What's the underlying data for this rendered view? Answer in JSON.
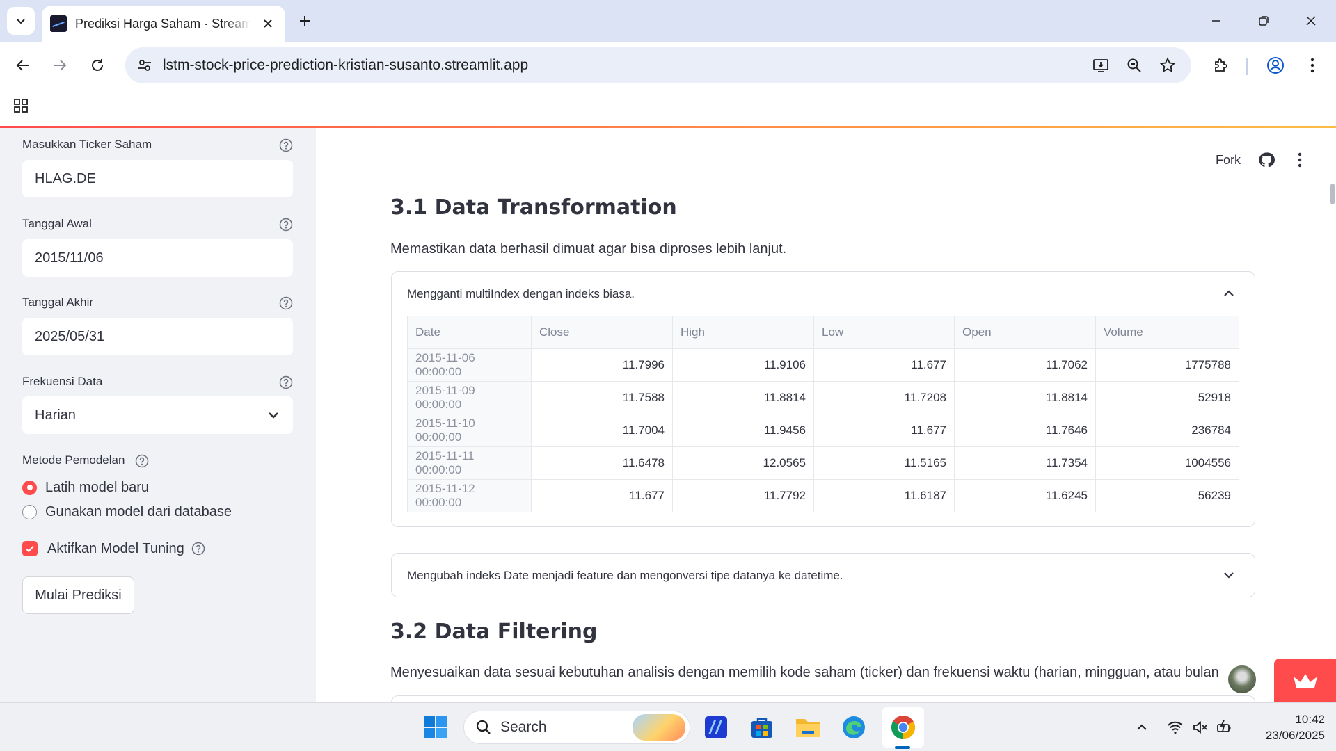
{
  "browser": {
    "tab_title": "Prediksi Harga Saham · Streamlit",
    "url": "lstm-stock-price-prediction-kristian-susanto.streamlit.app"
  },
  "sidebar": {
    "ticker_label": "Masukkan Ticker Saham",
    "ticker_value": "HLAG.DE",
    "start_label": "Tanggal Awal",
    "start_value": "2015/11/06",
    "end_label": "Tanggal Akhir",
    "end_value": "2025/05/31",
    "freq_label": "Frekuensi Data",
    "freq_value": "Harian",
    "method_label": "Metode Pemodelan",
    "method_options": [
      "Latih model baru",
      "Gunakan model dari database"
    ],
    "tuning_label": "Aktifkan Model Tuning",
    "start_button": "Mulai Prediksi"
  },
  "main": {
    "fork_label": "Fork",
    "section1_title": "3.1 Data Transformation",
    "section1_desc": "Memastikan data berhasil dimuat agar bisa diproses lebih lanjut.",
    "expander1_title": "Mengganti multiIndex dengan indeks biasa.",
    "table": {
      "columns": [
        "Date",
        "Close",
        "High",
        "Low",
        "Open",
        "Volume"
      ],
      "rows": [
        [
          "2015-11-06 00:00:00",
          "11.7996",
          "11.9106",
          "11.677",
          "11.7062",
          "1775788"
        ],
        [
          "2015-11-09 00:00:00",
          "11.7588",
          "11.8814",
          "11.7208",
          "11.8814",
          "52918"
        ],
        [
          "2015-11-10 00:00:00",
          "11.7004",
          "11.9456",
          "11.677",
          "11.7646",
          "236784"
        ],
        [
          "2015-11-11 00:00:00",
          "11.6478",
          "12.0565",
          "11.5165",
          "11.7354",
          "1004556"
        ],
        [
          "2015-11-12 00:00:00",
          "11.677",
          "11.7792",
          "11.6187",
          "11.6245",
          "56239"
        ]
      ]
    },
    "expander2_title": "Mengubah indeks Date menjadi feature dan mengonversi tipe datanya ke datetime.",
    "section2_title": "3.2 Data Filtering",
    "section2_desc": "Menyesuaikan data sesuai kebutuhan analisis dengan memilih kode saham (ticker) dan frekuensi waktu (harian, mingguan, atau bulan"
  },
  "taskbar": {
    "search_placeholder": "Search",
    "time": "10:42",
    "date": "23/06/2025"
  },
  "colors": {
    "accent": "#ff4b4b",
    "sidebar_bg": "#f0f2f6",
    "tabstrip_bg": "#dbe3f4"
  }
}
